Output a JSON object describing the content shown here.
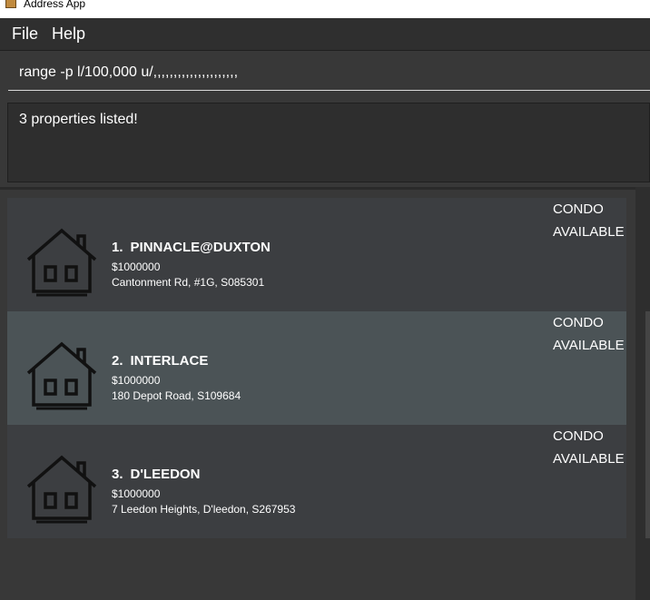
{
  "window": {
    "title": "Address App"
  },
  "menu": {
    "file": "File",
    "help": "Help"
  },
  "command": {
    "value": "range -p l/100,000 u/,,,,,,,,,,,,,,,,,,,,,"
  },
  "result": {
    "message": "3 properties listed!"
  },
  "properties": [
    {
      "index": "1.",
      "name": "PINNACLE@DUXTON",
      "price": "$1000000",
      "address": "Cantonment Rd, #1G, S085301",
      "type": "CONDO",
      "status": "AVAILABLE",
      "selected": false
    },
    {
      "index": "2.",
      "name": "INTERLACE",
      "price": "$1000000",
      "address": "180 Depot Road, S109684",
      "type": "CONDO",
      "status": "AVAILABLE",
      "selected": true
    },
    {
      "index": "3.",
      "name": "D'LEEDON",
      "price": "$1000000",
      "address": "7 Leedon Heights, D'leedon, S267953",
      "type": "CONDO",
      "status": "AVAILABLE",
      "selected": false
    }
  ],
  "icons": {
    "property": "house-icon",
    "app": "app-icon"
  },
  "colors": {
    "background": "#383838",
    "card": "#3c3e41",
    "card_selected": "#4b5356",
    "text": "#ffffff"
  }
}
